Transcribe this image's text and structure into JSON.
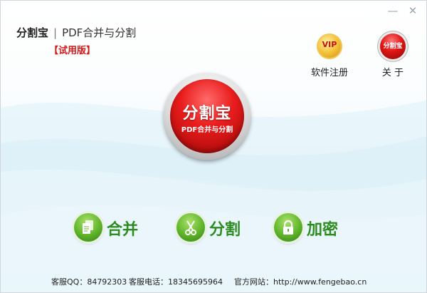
{
  "window": {
    "minimize_glyph": "—",
    "close_glyph": "✕"
  },
  "brand": {
    "name": "分割宝",
    "separator": "|",
    "subtitle": "PDF合并与分割",
    "trial": "【试用版】"
  },
  "top_actions": [
    {
      "label": "软件注册",
      "badge_text": "VIP",
      "icon": "vip-icon"
    },
    {
      "label": "关 于",
      "badge_text": "分割宝",
      "icon": "about-logo-icon"
    }
  ],
  "logo": {
    "title": "分割宝",
    "subtitle": "PDF合并与分割"
  },
  "actions": [
    {
      "label": "合并",
      "icon": "documents-icon"
    },
    {
      "label": "分割",
      "icon": "scissors-icon"
    },
    {
      "label": "加密",
      "icon": "lock-icon"
    }
  ],
  "footer": {
    "qq": "客服QQ：84792303",
    "phone": "客服电话：18345695964",
    "site": "官方网站：http://www.fengebao.cn"
  },
  "colors": {
    "accent_red": "#e01515",
    "action_green": "#2d8c20",
    "trial_red": "#d21a1a"
  }
}
